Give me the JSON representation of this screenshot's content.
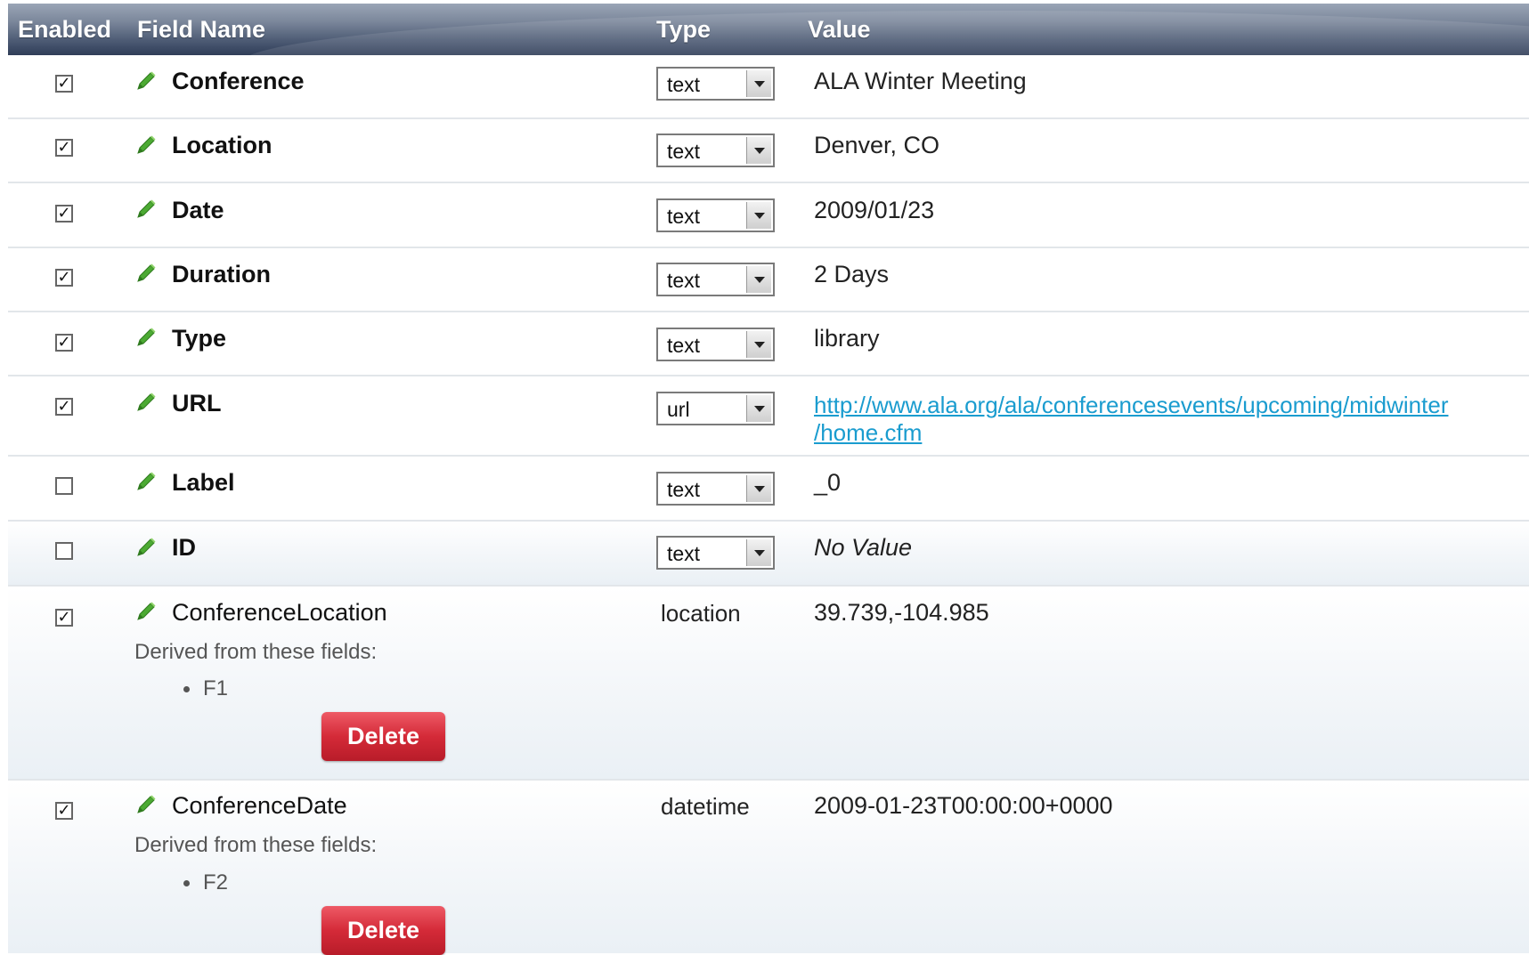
{
  "header": {
    "enabled": "Enabled",
    "field_name": "Field Name",
    "type": "Type",
    "value": "Value"
  },
  "rows": [
    {
      "enabled": true,
      "name": "Conference",
      "type": "text",
      "value": "ALA Winter Meeting"
    },
    {
      "enabled": true,
      "name": "Location",
      "type": "text",
      "value": "Denver, CO"
    },
    {
      "enabled": true,
      "name": "Date",
      "type": "text",
      "value": "2009/01/23"
    },
    {
      "enabled": true,
      "name": "Duration",
      "type": "text",
      "value": "2 Days"
    },
    {
      "enabled": true,
      "name": "Type",
      "type": "text",
      "value": "library"
    },
    {
      "enabled": true,
      "name": "URL",
      "type": "url",
      "value_line1": "http://www.ala.org/ala/conferencesevents/upcoming/midwinter",
      "value_line2": "/home.cfm"
    },
    {
      "enabled": false,
      "name": "Label",
      "type": "text",
      "value": "_0"
    },
    {
      "enabled": false,
      "name": "ID",
      "type": "text",
      "value": "No Value"
    }
  ],
  "derived_rows": [
    {
      "enabled": true,
      "name": "ConferenceLocation",
      "type": "location",
      "value": "39.739,-104.985",
      "derived_label": "Derived from these fields:",
      "fields": [
        "F1"
      ],
      "delete_label": "Delete"
    },
    {
      "enabled": true,
      "name": "ConferenceDate",
      "type": "datetime",
      "value": "2009-01-23T00:00:00+0000",
      "derived_label": "Derived from these fields:",
      "fields": [
        "F2"
      ],
      "delete_label": "Delete"
    }
  ],
  "icons": {
    "edit": "pencil-icon",
    "checked": "checkbox-checked",
    "unchecked": "checkbox-unchecked",
    "dropdown": "chevron-down-icon"
  },
  "colors": {
    "header_dark": "#2f3d58",
    "link": "#1a9ccf",
    "delete_button": "#d42a38",
    "pencil": "#3f9a2a"
  }
}
